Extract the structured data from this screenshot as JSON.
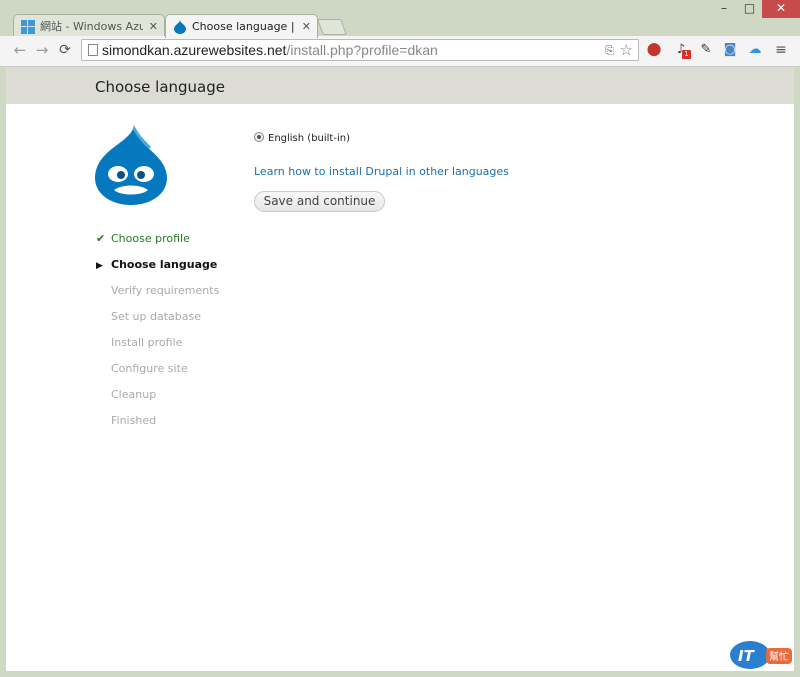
{
  "browser": {
    "tabs": [
      {
        "title": "網站 - Windows Azure",
        "active": false
      },
      {
        "title": "Choose language | Drupal",
        "active": true
      }
    ],
    "window_controls": {
      "minimize": "–",
      "maximize": "□",
      "close": "✕"
    },
    "address_bar": {
      "host": "simondkan.azurewebsites.net",
      "path": "/install.php?profile=dkan"
    },
    "notification_badge": "1"
  },
  "page": {
    "title": "Choose language",
    "language_option": "English (built-in)",
    "learn_link": "Learn how to install Drupal in other languages",
    "save_button": "Save and continue",
    "steps": [
      {
        "label": "Choose profile",
        "state": "done"
      },
      {
        "label": "Choose language",
        "state": "active"
      },
      {
        "label": "Verify requirements",
        "state": "pending"
      },
      {
        "label": "Set up database",
        "state": "pending"
      },
      {
        "label": "Install profile",
        "state": "pending"
      },
      {
        "label": "Configure site",
        "state": "pending"
      },
      {
        "label": "Cleanup",
        "state": "pending"
      },
      {
        "label": "Finished",
        "state": "pending"
      }
    ]
  },
  "watermark": {
    "text": "IT",
    "subtext": "幫忙"
  },
  "colors": {
    "drupal_blue": "#0678be",
    "done_green": "#237b23",
    "link_blue": "#1a6fb0",
    "header_bg": "#dcdcd4"
  }
}
